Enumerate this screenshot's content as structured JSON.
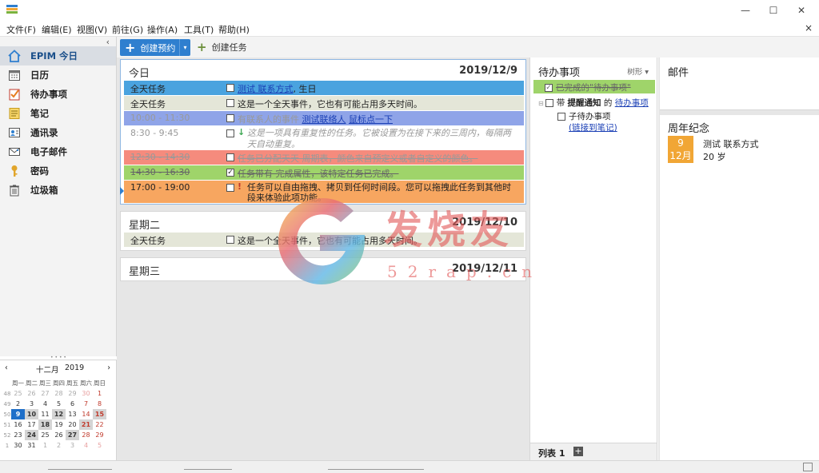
{
  "window": {
    "min": "—",
    "max": "☐",
    "close": "✕"
  },
  "menu": [
    "文件(F)",
    "编辑(E)",
    "视图(V)",
    "前往(G)",
    "操作(A)",
    "工具(T)",
    "帮助(H)"
  ],
  "menu_close": "×",
  "sidebar": {
    "collapse": "‹",
    "items": [
      {
        "label": "EPIM 今日",
        "icon": "home-icon"
      },
      {
        "label": "日历",
        "icon": "calendar-icon"
      },
      {
        "label": "待办事项",
        "icon": "tasks-icon"
      },
      {
        "label": "笔记",
        "icon": "notes-icon"
      },
      {
        "label": "通讯录",
        "icon": "contacts-icon"
      },
      {
        "label": "电子邮件",
        "icon": "email-icon"
      },
      {
        "label": "密码",
        "icon": "key-icon"
      },
      {
        "label": "垃圾箱",
        "icon": "trash-icon"
      }
    ]
  },
  "minical": {
    "prev": "‹",
    "next": "›",
    "month": "十二月",
    "year": "2019",
    "weekdays": [
      "周一",
      "周二",
      "周三",
      "周四",
      "周五",
      "周六",
      "周日"
    ],
    "weeks": [
      {
        "wk": "48",
        "days": [
          "25",
          "26",
          "27",
          "28",
          "29",
          "30",
          "1"
        ]
      },
      {
        "wk": "49",
        "days": [
          "2",
          "3",
          "4",
          "5",
          "6",
          "7",
          "8"
        ]
      },
      {
        "wk": "50",
        "days": [
          "9",
          "10",
          "11",
          "12",
          "13",
          "14",
          "15"
        ]
      },
      {
        "wk": "51",
        "days": [
          "16",
          "17",
          "18",
          "19",
          "20",
          "21",
          "22"
        ]
      },
      {
        "wk": "52",
        "days": [
          "23",
          "24",
          "25",
          "26",
          "27",
          "28",
          "29"
        ]
      },
      {
        "wk": "1",
        "days": [
          "30",
          "31",
          "1",
          "2",
          "3",
          "4",
          "5"
        ]
      }
    ]
  },
  "toolbar": {
    "new_appointment": "创建预约",
    "new_appointment_plus": "+",
    "new_appointment_dropdown": "▾",
    "new_task": "创建任务",
    "new_task_plus": "+"
  },
  "today": {
    "title": "今日",
    "date": "2019/12/9",
    "events": [
      {
        "time": "全天任务",
        "check": "",
        "pre": "",
        "link1": "测试 联系方式",
        "mid": "",
        "link2": "",
        "post": ", 生日",
        "color": "#4aa3df"
      },
      {
        "time": "全天任务",
        "check": "",
        "pre": "这是一个全天事件，它也有可能占用多天时间。",
        "link1": "",
        "mid": "",
        "link2": "",
        "post": "",
        "color": "#e4e6d8"
      },
      {
        "time": "10:00 - 11:30",
        "check": "",
        "pre": "有联系人的事件",
        "link1": "测试联络人",
        "mid": " ",
        "link2": "鼠标点一下",
        "post": "",
        "color": "#8fa4e8"
      },
      {
        "time": "8:30 - 9:45",
        "check": "",
        "mark": "↓",
        "pre": "这是一项具有重复性的任务。它被设置为在接下来的三周内，每隔两天自动重复。",
        "link1": "",
        "mid": "",
        "link2": "",
        "post": "",
        "color": "#ffffff"
      },
      {
        "time": "12:30 - 14:30",
        "check": "",
        "pre": "任务已分配天天 周期表，颜色来自预定义或者自定义的颜色。",
        "link1": "",
        "mid": "",
        "link2": "",
        "post": "",
        "color": "#f58b7d"
      },
      {
        "time": "14:30 - 16:30",
        "check": "✓",
        "pre": "任务带有 完成属性，该特定任务已完成。",
        "link1": "",
        "mid": "",
        "link2": "",
        "post": "",
        "color": "#9fd46a"
      },
      {
        "time": "17:00 - 19:00",
        "check": "",
        "mark": "!",
        "pre": "任务可以自由拖拽、拷贝到任何时间段。您可以拖拽此任务到其他时段来体验此项功能。",
        "link1": "",
        "mid": "",
        "link2": "",
        "post": "",
        "color": "#f7a660"
      }
    ]
  },
  "tuesday": {
    "title": "星期二",
    "date": "2019/12/10",
    "events": [
      {
        "time": "全天任务",
        "check": "",
        "pre": "这是一个全天事件，它也有可能占用多天时间。",
        "color": "#e4e6d8"
      }
    ]
  },
  "wednesday": {
    "title": "星期三",
    "date": "2019/12/11"
  },
  "tasks": {
    "title": "待办事项",
    "view": "树形 ▾",
    "completed": "已完成的\"待办事项\"",
    "completed_check": "✓",
    "reminder_prefix": "带 ",
    "reminder_bold": "提醒通知",
    "reminder_mid": " 的 ",
    "reminder_link": "待办事项",
    "subtask": "子待办事项",
    "subtask_link": "(链接到笔记)",
    "tab": "列表 1",
    "tab_add": "+"
  },
  "mail": {
    "title": "邮件"
  },
  "anniversary": {
    "title": "周年纪念",
    "day": "9",
    "month": "12月",
    "name": "测试 联系方式",
    "age": "20 岁"
  },
  "watermark": {
    "text": "发烧友",
    "sub": "52rap.cn"
  },
  "colors": {
    "accent": "#2f7fcf",
    "completed_green": "#9fd46a",
    "badge_orange": "#f1a635"
  }
}
